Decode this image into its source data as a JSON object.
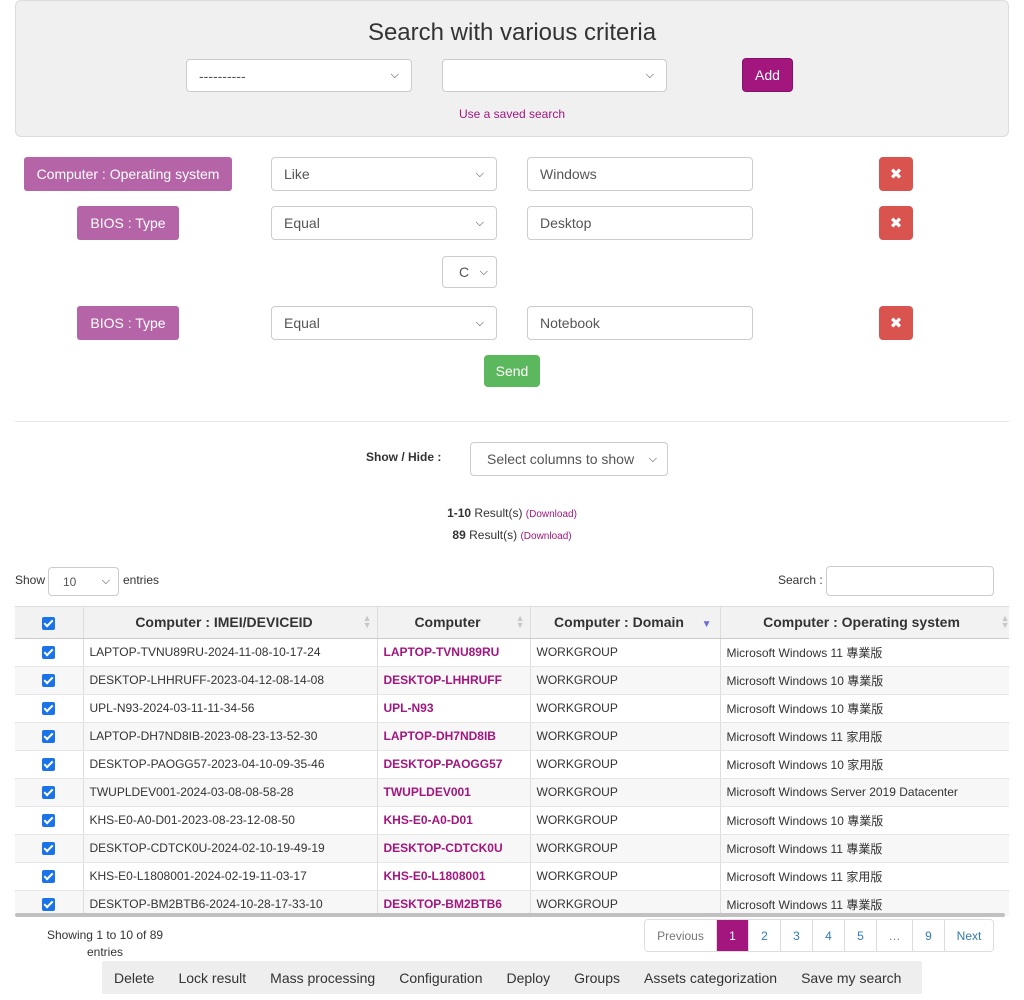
{
  "search": {
    "title": "Search with various criteria",
    "field_select": "----------",
    "value_select": "",
    "add_label": "Add",
    "saved_search_link": "Use a saved search"
  },
  "criteria": [
    {
      "label": "Computer : Operating system",
      "operator": "Like",
      "value": "Windows"
    },
    {
      "label": "BIOS : Type",
      "operator": "Equal",
      "value": "Desktop"
    },
    {
      "label": "BIOS : Type",
      "operator": "Equal",
      "value": "Notebook"
    }
  ],
  "link_operator": "C",
  "send_label": "Send",
  "columns_control": {
    "label": "Show / Hide :",
    "select": "Select columns to show"
  },
  "results": {
    "range_bold": "1-10",
    "range_text": " Result(s)",
    "total_bold": "89",
    "total_text": " Result(s)",
    "download": "(Download)"
  },
  "length": {
    "show": "Show",
    "value": "10",
    "entries": "entries"
  },
  "search_box": {
    "label": "Search :",
    "value": ""
  },
  "table": {
    "headers": [
      "Computer : IMEI/DEVICEID",
      "Computer",
      "Computer : Domain",
      "Computer : Operating system"
    ],
    "rows": [
      [
        "LAPTOP-TVNU89RU-2024-11-08-10-17-24",
        "LAPTOP-TVNU89RU",
        "WORKGROUP",
        "Microsoft Windows 11 專業版"
      ],
      [
        "DESKTOP-LHHRUFF-2023-04-12-08-14-08",
        "DESKTOP-LHHRUFF",
        "WORKGROUP",
        "Microsoft Windows 10 專業版"
      ],
      [
        "UPL-N93-2024-03-11-11-34-56",
        "UPL-N93",
        "WORKGROUP",
        "Microsoft Windows 10 專業版"
      ],
      [
        "LAPTOP-DH7ND8IB-2023-08-23-13-52-30",
        "LAPTOP-DH7ND8IB",
        "WORKGROUP",
        "Microsoft Windows 11 家用版"
      ],
      [
        "DESKTOP-PAOGG57-2023-04-10-09-35-46",
        "DESKTOP-PAOGG57",
        "WORKGROUP",
        "Microsoft Windows 10 家用版"
      ],
      [
        "TWUPLDEV001-2024-03-08-08-58-28",
        "TWUPLDEV001",
        "WORKGROUP",
        "Microsoft Windows Server 2019 Datacenter"
      ],
      [
        "KHS-E0-A0-D01-2023-08-23-12-08-50",
        "KHS-E0-A0-D01",
        "WORKGROUP",
        "Microsoft Windows 10 專業版"
      ],
      [
        "DESKTOP-CDTCK0U-2024-02-10-19-49-19",
        "DESKTOP-CDTCK0U",
        "WORKGROUP",
        "Microsoft Windows 11 專業版"
      ],
      [
        "KHS-E0-L1808001-2024-02-19-11-03-17",
        "KHS-E0-L1808001",
        "WORKGROUP",
        "Microsoft Windows 11 家用版"
      ],
      [
        "DESKTOP-BM2BTB6-2024-10-28-17-33-10",
        "DESKTOP-BM2BTB6",
        "WORKGROUP",
        "Microsoft Windows 11 專業版"
      ]
    ]
  },
  "info": {
    "line1": "Showing 1 to 10 of 89",
    "line2": "entries"
  },
  "pagination": {
    "previous": "Previous",
    "pages": [
      "1",
      "2",
      "3",
      "4",
      "5",
      "…",
      "9"
    ],
    "next": "Next",
    "active": "1"
  },
  "toolbar": [
    "Delete",
    "Lock result",
    "Mass processing",
    "Configuration",
    "Deploy",
    "Groups",
    "Assets categorization",
    "Save my search"
  ],
  "colors": {
    "brand": "#a3167e",
    "criteria_label": "#b565a7",
    "delete": "#d9534f",
    "send": "#5cb85c",
    "checkbox": "#1a73e8"
  }
}
